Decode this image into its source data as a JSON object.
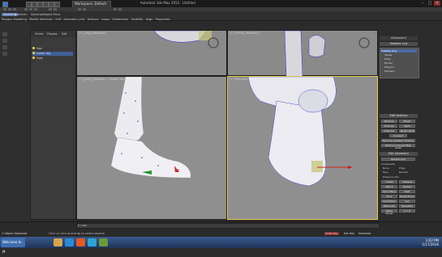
{
  "titlebar": {
    "workspace": "Workspace: Default",
    "window_title": "Autodesk 3ds Max 2015 · Untitled",
    "minimize": "–",
    "maximize": "□",
    "close": "×"
  },
  "ribbon": {
    "tabs": [
      "Modeling",
      "Freeform",
      "Selection",
      "Object Paint"
    ],
    "row": [
      "Polygon Modeling",
      "Modify Selection",
      "Edit",
      "Geometry (All)",
      "Vertices",
      "Loops",
      "Subdivision",
      "Visibility",
      "Align",
      "Properties"
    ]
  },
  "explorer": {
    "tabs": [
      "Select",
      "Display",
      "Edit"
    ],
    "items": [
      "Sea",
      "Lower leg",
      "Foot"
    ]
  },
  "viewports": {
    "top_left": "[+] [Top] [Realistic]",
    "top_right": "[+] [Front] [Realistic]",
    "bottom_left": "[+] [Left] [Realistic + Edged Faces]",
    "bottom_right": "[+] [Perspective] [Realistic + Edged Faces]"
  },
  "command_panel": {
    "object_name": "Character1",
    "modifier_list": "Modifier List",
    "stack": [
      "Editable Poly",
      "Vertex",
      "Edge",
      "Border",
      "Polygon",
      "Element"
    ],
    "edit_vertices_title": "Edit Vertices",
    "edit_vertices_buttons": [
      "Remove",
      "Break",
      "Extrude",
      "Weld",
      "Chamfer",
      "Target Weld",
      "Connect"
    ],
    "remove_isolated": "Remove Isolated Vertices",
    "remove_unused": "Remove Unused Map Verts",
    "edit_geometry_title": "Edit Geometry",
    "repeat_last": "Repeat Last",
    "constraints": "Constraints",
    "constraint_options": [
      "None",
      "Edge",
      "Face",
      "Normal"
    ],
    "preserve_uvs": "Preserve UVs",
    "geometry_buttons": [
      "Create",
      "Collapse",
      "Attach",
      "Detach",
      "Slice Plane",
      "Split",
      "Slice",
      "Reset Plane",
      "QuickSlice",
      "Cut",
      "MSmooth",
      "Tessellate",
      "Make Planar",
      "X Y Z"
    ]
  },
  "status": {
    "selection": "1 Object Selected",
    "prompt": "Click or click-and-drag to select objects",
    "frame": "0 / 100",
    "autokey": "Auto Key",
    "setkey": "Set Key",
    "selected": "Selected"
  },
  "taskbar": {
    "start": "Welcome to M",
    "time": "3:02 PM",
    "date": "1/17/2016"
  }
}
